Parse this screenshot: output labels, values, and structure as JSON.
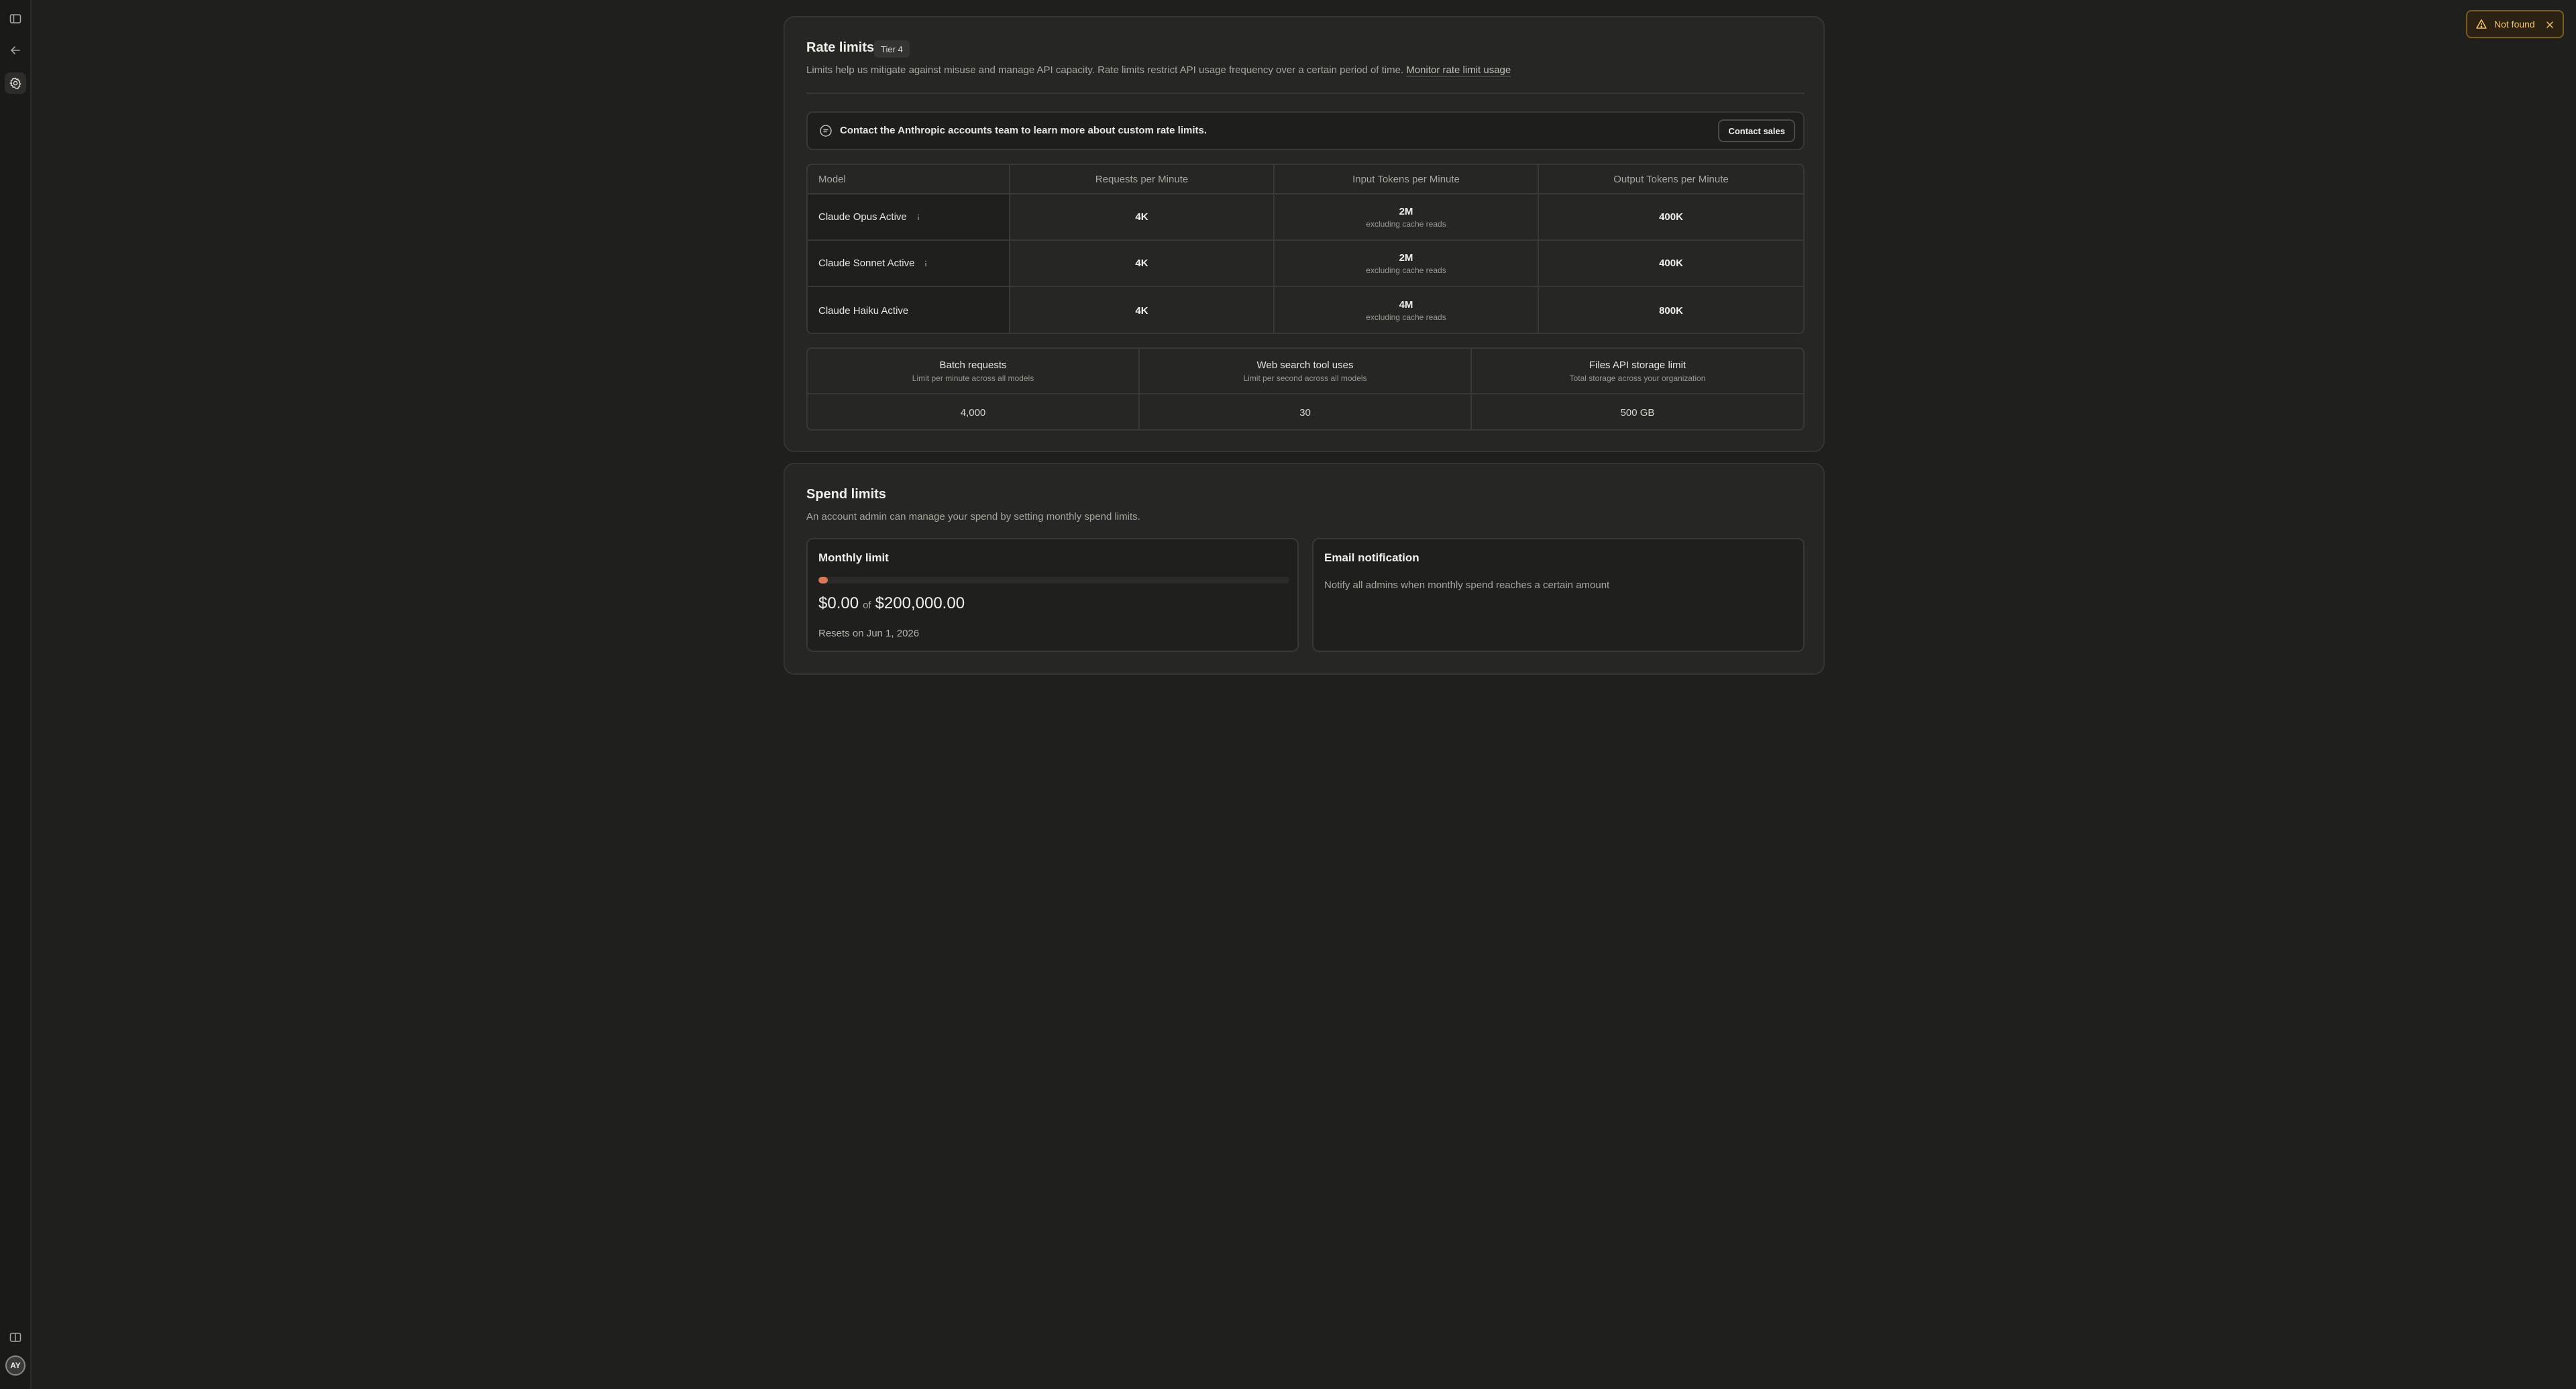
{
  "sidebar": {
    "icons": [
      "sidebar-toggle-icon",
      "back-arrow-icon",
      "settings-icon",
      "panel-icon"
    ],
    "avatar_initials": "AY"
  },
  "rate_limits": {
    "title": "Rate limits",
    "tier": "Tier 4",
    "description": "Limits help us mitigate against misuse and manage API capacity. Rate limits restrict API usage frequency over a certain period of time.",
    "monitor_link": "Monitor rate limit usage",
    "contact_text": "Contact the Anthropic accounts team to learn more about custom rate limits.",
    "contact_button": "Contact sales",
    "table": {
      "headers": [
        "Model",
        "Requests per Minute",
        "Input Tokens per Minute",
        "Output Tokens per Minute"
      ],
      "rows": [
        {
          "model": "Claude Opus Active",
          "info": true,
          "rpm": "4K",
          "itpm": "2M",
          "itpm_note": "excluding cache reads",
          "otpm": "400K"
        },
        {
          "model": "Claude Sonnet Active",
          "info": true,
          "rpm": "4K",
          "itpm": "2M",
          "itpm_note": "excluding cache reads",
          "otpm": "400K"
        },
        {
          "model": "Claude Haiku Active",
          "info": false,
          "rpm": "4K",
          "itpm": "4M",
          "itpm_note": "excluding cache reads",
          "otpm": "800K"
        }
      ]
    },
    "other_limits": [
      {
        "title": "Batch requests",
        "subtitle": "Limit per minute across all models",
        "value": "4,000"
      },
      {
        "title": "Web search tool uses",
        "subtitle": "Limit per second across all models",
        "value": "30"
      },
      {
        "title": "Files API storage limit",
        "subtitle": "Total storage across your organization",
        "value": "500 GB"
      }
    ]
  },
  "spend_limits": {
    "title": "Spend limits",
    "description": "An account admin can manage your spend by setting monthly spend limits.",
    "monthly": {
      "title": "Monthly limit",
      "spent": "$0.00",
      "of": "of",
      "limit": "$200,000.00",
      "progress_fraction": 0.0,
      "resets": "Resets on Jun 1, 2026"
    },
    "email": {
      "title": "Email notification",
      "description": "Notify all admins when monthly spend reaches a certain amount"
    }
  },
  "toast": {
    "text": "Not found",
    "icon": "warning-icon"
  },
  "colors": {
    "accent": "#d97757",
    "toast_text": "#f2c26a",
    "background": "#1f1f1e"
  }
}
